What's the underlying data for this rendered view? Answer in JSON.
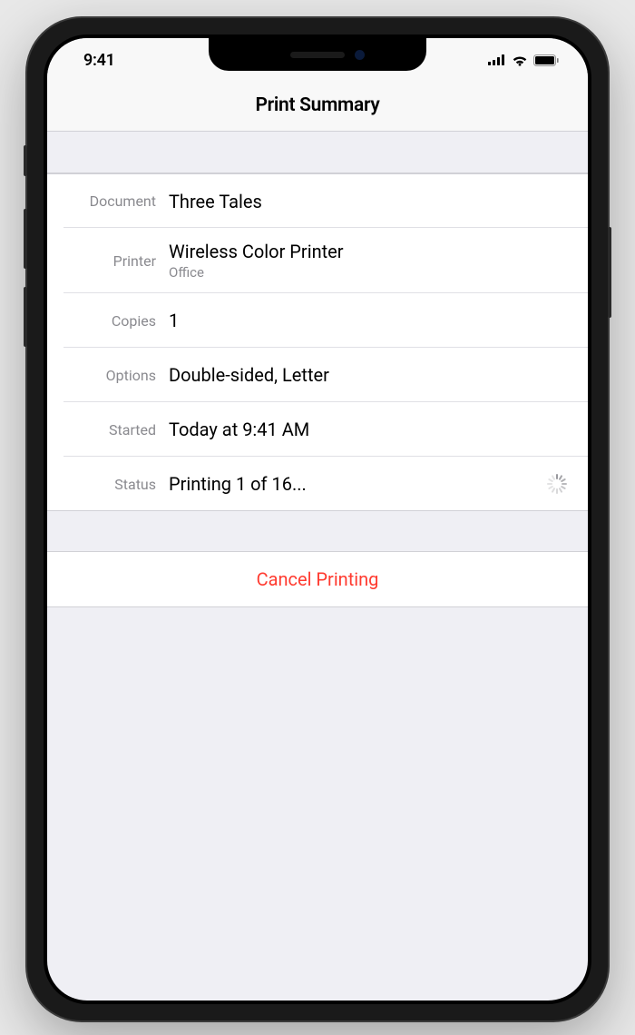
{
  "status_bar": {
    "time": "9:41"
  },
  "header": {
    "title": "Print Summary"
  },
  "labels": {
    "document": "Document",
    "printer": "Printer",
    "copies": "Copies",
    "options": "Options",
    "started": "Started",
    "status": "Status"
  },
  "values": {
    "document": "Three Tales",
    "printer": "Wireless Color Printer",
    "printer_location": "Office",
    "copies": "1",
    "options": "Double-sided, Letter",
    "started": "Today at 9:41 AM",
    "status": "Printing 1 of 16..."
  },
  "actions": {
    "cancel": "Cancel Printing"
  }
}
